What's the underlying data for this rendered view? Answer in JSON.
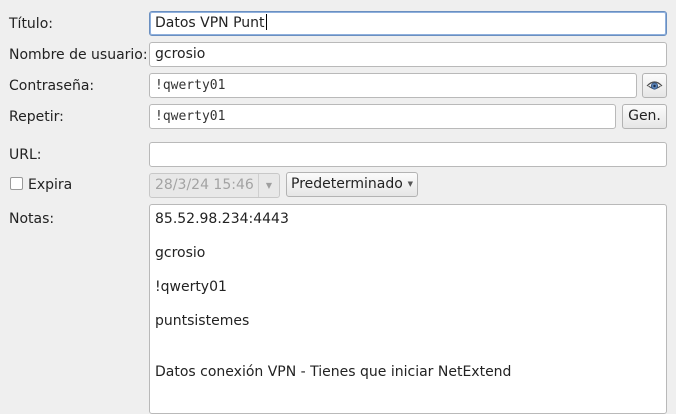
{
  "fields": {
    "title": {
      "label": "Título:",
      "value": "Datos VPN Punt"
    },
    "username": {
      "label": "Nombre de usuario:",
      "value": "gcrosio"
    },
    "password": {
      "label": "Contraseña:",
      "value": "!qwerty01",
      "toggle_icon": "eye-icon"
    },
    "repeat": {
      "label": "Repetir:",
      "value": "!qwerty01",
      "gen_label": "Gen."
    },
    "url": {
      "label": "URL:",
      "value": ""
    },
    "expires": {
      "label": "Expira",
      "checked": false,
      "date_value": "28/3/24 15:46",
      "preset_value": "Predeterminado"
    },
    "notes": {
      "label": "Notas:",
      "lines": [
        "85.52.98.234:4443",
        "gcrosio",
        "!qwerty01",
        "puntsistemes",
        "",
        "Datos conexión VPN - Tienes que iniciar NetExtend"
      ]
    }
  }
}
